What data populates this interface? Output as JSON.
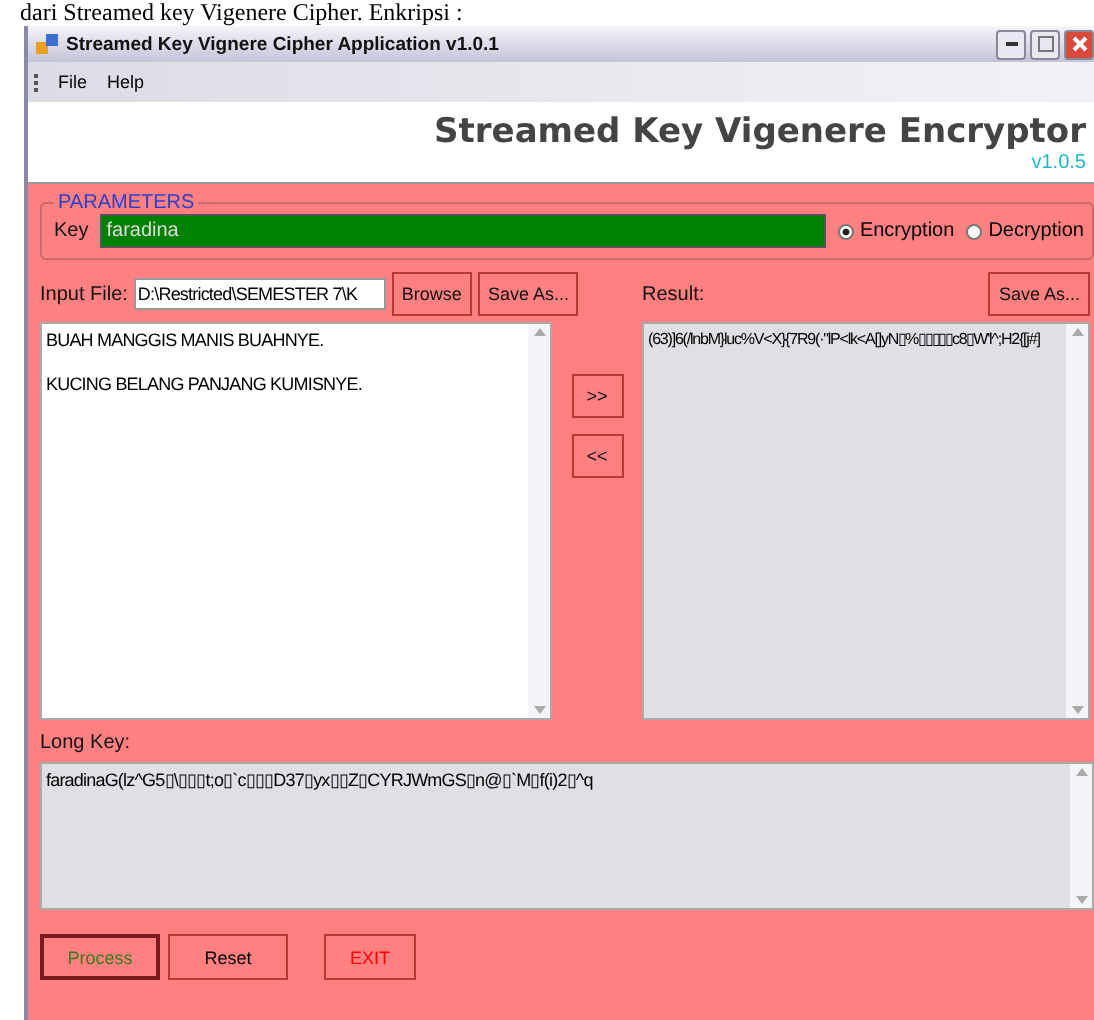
{
  "caption": "dari Streamed key Vigenere Cipher. Enkripsi :",
  "window": {
    "title": "Streamed Key Vignere Cipher Application v1.0.1"
  },
  "menu": [
    "File",
    "Help"
  ],
  "header": {
    "title": "Streamed Key Vigenere Encryptor",
    "version": "v1.0.5"
  },
  "parameters": {
    "legend": "PARAMETERS",
    "key_label": "Key",
    "key_value": "faradina",
    "modes": [
      {
        "label": "Encryption",
        "selected": true
      },
      {
        "label": "Decryption",
        "selected": false
      }
    ]
  },
  "input_file": {
    "label": "Input File:",
    "value": "D:\\Restricted\\SEMESTER 7\\K",
    "buttons": [
      "Browse",
      "Save As..."
    ]
  },
  "result": {
    "label": "Result:",
    "button": "Save As...",
    "text": "(63)]6(/lnbM}luc%V<X}{7R9(·\"lP<lk<A[]yN▯%▯▯▯▯▯c8▯W'l^;H2{[j#]"
  },
  "input_text": [
    "BUAH MANGGIS MANIS BUAHNYE.",
    "KUCING BELANG PANJANG KUMISNYE."
  ],
  "transfer_buttons": [
    ">>",
    "<<"
  ],
  "long_key": {
    "label": "Long Key:",
    "text": "faradinaG(lz^G5▯\\▯▯▯t;o▯`c▯▯▯D37▯yx▯▯Z▯CYRJWmGS▯n@▯`M▯f(i)2▯^q"
  },
  "actions": [
    {
      "label": "Process",
      "color": "#3a7a1a",
      "focused": true
    },
    {
      "label": "Reset",
      "color": "#000000",
      "focused": false
    },
    {
      "label": "EXIT",
      "color": "#ff0000",
      "focused": false
    }
  ]
}
